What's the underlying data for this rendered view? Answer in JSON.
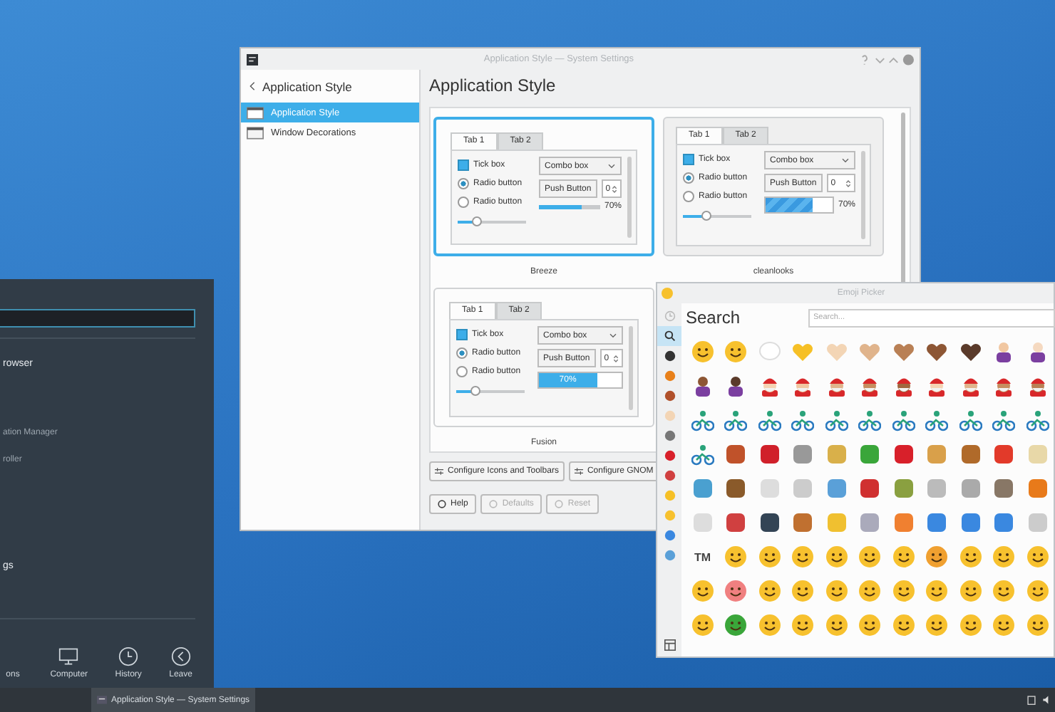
{
  "launcher": {
    "entries": [
      "rowser",
      "ation Manager",
      "roller",
      "gs"
    ],
    "nav": [
      {
        "label": "ons",
        "kind": "none"
      },
      {
        "label": "Computer",
        "kind": "computer"
      },
      {
        "label": "History",
        "kind": "history"
      },
      {
        "label": "Leave",
        "kind": "leave"
      }
    ]
  },
  "settings": {
    "title": "Application Style — System Settings",
    "sidebar_header": "Application Style",
    "sidebar_items": [
      {
        "label": "Application Style",
        "selected": true
      },
      {
        "label": "Window Decorations",
        "selected": false
      }
    ],
    "heading": "Application Style",
    "styles": [
      {
        "name": "Breeze",
        "kind": "breeze",
        "selected": true,
        "tabs": [
          {
            "label": "Tab 1",
            "selected": true
          },
          {
            "label": "Tab 2",
            "selected": false
          }
        ],
        "checkbox": {
          "label": "Tick box",
          "checked": true
        },
        "radios": [
          {
            "label": "Radio button",
            "selected": true
          },
          {
            "label": "Radio button",
            "selected": false
          }
        ],
        "combo": "Combo box",
        "push": "Push Button",
        "spin": "0",
        "slider": {
          "level": 0.3
        },
        "progress": {
          "level": 0.7,
          "reading": "70%"
        }
      },
      {
        "name": "cleanlooks",
        "kind": "cleanlooks",
        "selected": false,
        "tabs": [
          {
            "label": "Tab 1",
            "selected": true
          },
          {
            "label": "Tab 2",
            "selected": false
          }
        ],
        "checkbox": {
          "label": "Tick box",
          "checked": true
        },
        "radios": [
          {
            "label": "Radio button",
            "selected": true
          },
          {
            "label": "Radio button",
            "selected": false
          }
        ],
        "combo": "Combo box",
        "push": "Push Button",
        "spin": "0",
        "slider": {
          "level": 0.35
        },
        "progress": {
          "level": 0.7,
          "reading": "70%"
        }
      },
      {
        "name": "Fusion",
        "kind": "fusion",
        "selected": false,
        "tabs": [
          {
            "label": "Tab 1",
            "selected": true
          },
          {
            "label": "Tab 2",
            "selected": false
          }
        ],
        "checkbox": {
          "label": "Tick box",
          "checked": true
        },
        "radios": [
          {
            "label": "Radio button",
            "selected": true
          },
          {
            "label": "Radio button",
            "selected": false
          }
        ],
        "combo": "Combo box",
        "push": "Push Button",
        "spin": "0",
        "slider": {
          "level": 0.3
        },
        "progress": {
          "level": 0.7,
          "reading": "70%"
        }
      }
    ],
    "configure_buttons": [
      "Configure Icons and Toolbars",
      "Configure GNOM"
    ],
    "footer_buttons": [
      {
        "label": "Help",
        "disabled": false
      },
      {
        "label": "Defaults",
        "disabled": true
      },
      {
        "label": "Reset",
        "disabled": true
      }
    ]
  },
  "emoji_picker": {
    "title": "Emoji Picker",
    "heading": "Search",
    "search": {
      "placeholder": "Search..."
    },
    "categories": [
      {
        "selected": false
      },
      {
        "selected": true
      },
      {
        "selected": false
      },
      {
        "selected": false
      },
      {
        "selected": false
      },
      {
        "selected": false
      },
      {
        "selected": false
      },
      {
        "selected": false
      },
      {
        "selected": false
      },
      {
        "selected": false
      },
      {
        "selected": false
      },
      {
        "selected": false
      },
      {
        "selected": false
      }
    ],
    "text_symbol": "TM"
  },
  "taskbar": {
    "tasks": [
      {
        "label": "Application Style  — System Settings",
        "selected": true
      }
    ]
  }
}
